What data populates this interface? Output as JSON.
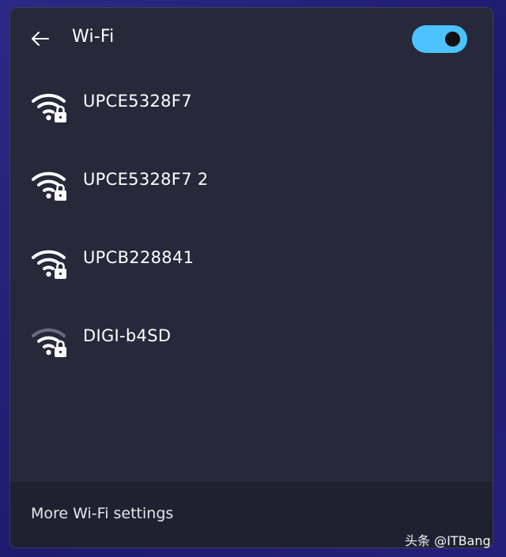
{
  "header": {
    "title": "Wi-Fi",
    "back_icon": "arrow-left-icon",
    "wifi_toggle": {
      "state": "on",
      "color": "#4cc2ff"
    }
  },
  "networks": [
    {
      "name": "UPCE5328F7",
      "signal": "full",
      "secured": true,
      "icon": "wifi-secured-icon"
    },
    {
      "name": "UPCE5328F7 2",
      "signal": "full",
      "secured": true,
      "icon": "wifi-secured-icon"
    },
    {
      "name": "UPCB228841",
      "signal": "full",
      "secured": true,
      "icon": "wifi-secured-icon"
    },
    {
      "name": "DIGI-b4SD",
      "signal": "medium",
      "secured": true,
      "icon": "wifi-secured-icon"
    }
  ],
  "footer": {
    "settings_label": "More Wi-Fi settings"
  },
  "watermark": "头条 @ITBang",
  "colors": {
    "panel": "#27283a",
    "footer": "#202130",
    "accent": "#4cc2ff",
    "background": "#1d1b6e"
  }
}
